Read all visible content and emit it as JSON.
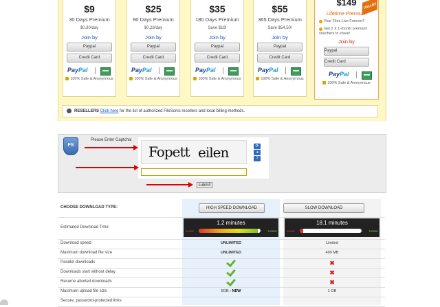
{
  "plans": [
    {
      "price": "$9",
      "days": "30 Days Premium",
      "per": "$0.30/day",
      "join": "Join by",
      "paypal_btn": "Paypal",
      "card_btn": "Credit Card",
      "safe": "100% Safe & Anonymous"
    },
    {
      "price": "$25",
      "days": "90 Days Premium",
      "per": "$0.28/day",
      "join": "Join by",
      "paypal_btn": "Paypal",
      "card_btn": "Credit Card",
      "safe": "100% Safe & Anonymous"
    },
    {
      "price": "$35",
      "days": "180 Days Premium",
      "per": "Save $19!",
      "join": "Join by",
      "paypal_btn": "Paypal",
      "card_btn": "Credit Card",
      "safe": "100% Safe & Anonymous"
    },
    {
      "price": "$55",
      "days": "365 Days Premium",
      "per": "Save $54.50!",
      "join": "Join by",
      "paypal_btn": "Paypal",
      "card_btn": "Credit Card",
      "safe": "100% Safe & Anonymous"
    }
  ],
  "paypal_logo": {
    "pay": "Pay",
    "pal": "Pal"
  },
  "lifetime": {
    "price": "$149",
    "title": "Lifetime Premium",
    "features": [
      "Your Files Live Forever!!",
      "Get 2 X 1-month premium vouchers to share!"
    ],
    "join": "Join by",
    "paypal_btn": "Paypal",
    "card_btn": "Credit Card",
    "safe": "100% Safe & Anonymous",
    "badge": "VALUE!"
  },
  "resellers": {
    "label": "RESELLERS",
    "link": "Click here",
    "text": " for the list of authorized FileSonic resellers and local billing methods."
  },
  "captcha": {
    "logo": "FS",
    "label": "Please Enter Captcha:",
    "word1": "Fopett",
    "word2": "eilen",
    "input_value": "",
    "submit": "submit",
    "ctrl_refresh": "⟳",
    "ctrl_audio": "◂",
    "ctrl_help": "?"
  },
  "table": {
    "choose_label": "CHOOSE DOWNLOAD TYPE:",
    "high_btn": "HIGH SPEED DOWNLOAD",
    "slow_btn": "SLOW DOWNLOAD",
    "est_label": "Estimated Download Time:",
    "high_time": "1.2 minutes",
    "slow_time": "18.1 minutes",
    "gauge_slow": "SLOW",
    "gauge_turbo": "TURBO",
    "high_speed_level": 0.95,
    "slow_speed_level": 0.05,
    "rows": [
      {
        "label": "Download speed",
        "high": "UNLIMITED",
        "slow": "Limited"
      },
      {
        "label": "Maximum download file size",
        "high": "UNLIMITED",
        "slow": "400 MB"
      },
      {
        "label": "Parallel downloads",
        "high": "check",
        "slow": "cross"
      },
      {
        "label": "Downloads start without delay",
        "high": "check",
        "slow": "cross"
      },
      {
        "label": "Resume aborted downloads",
        "high": "check",
        "slow": "cross"
      },
      {
        "label": "Maximum upload file size",
        "high": "5GB",
        "high_new": " - NEW",
        "slow": "1 GB"
      },
      {
        "label": "Secure, password-protected links",
        "high": "",
        "slow": ""
      }
    ]
  },
  "colors": {
    "accent_orange": "#e06000",
    "link_blue": "#1a55b0",
    "arrow_red": "#e00000",
    "check_green": "#66b032",
    "cross_red": "#d02020"
  }
}
